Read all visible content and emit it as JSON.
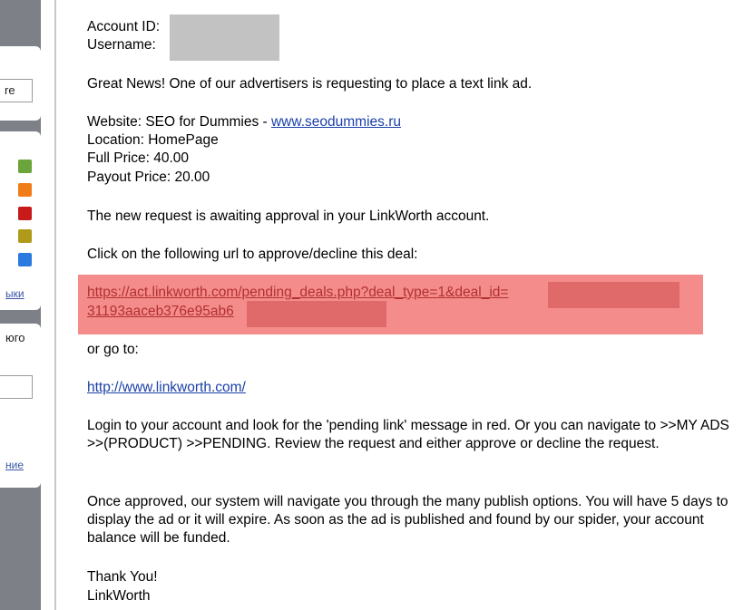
{
  "sidebar": {
    "input1_value": "re",
    "color_squares": [
      "#6aa43a",
      "#f07d1a",
      "#c81a1a",
      "#b09a1a",
      "#2a7ae0"
    ],
    "link1": "ыки",
    "label": "юго",
    "link2": "ние"
  },
  "email": {
    "account_id_label": "Account ID:",
    "username_label": "Username:",
    "intro": "Great News!  One of our advertisers is requesting to place a text link ad.",
    "website_label": "Website: SEO for Dummies - ",
    "website_link": "www.seodummies.ru",
    "location": "Location: HomePage",
    "full_price": "Full Price: 40.00",
    "payout_price": "Payout Price: 20.00",
    "awaiting": "The new request is awaiting approval in your LinkWorth account.",
    "click_instruction": "Click on the following url to approve/decline this deal:",
    "deal_url_line1": "https://act.linkworth.com/pending_deals.php?deal_type=1&deal_id=",
    "deal_url_line2": "31193aaceb376e95ab6",
    "or_go_to": "or go to:",
    "home_link": "http://www.linkworth.com/",
    "login_paragraph": "Login to your account and look for the 'pending link' message in red.  Or you can navigate to >>MY ADS >>(PRODUCT) >>PENDING.  Review the request and either approve or decline the request.",
    "approved_paragraph": "Once approved, our system will navigate you through the many publish options.  You will have 5 days to display the ad or it will expire.  As soon as the ad is published and found by our spider, your account balance will be funded.",
    "thanks": "Thank You!",
    "signature": "LinkWorth"
  },
  "colors": {
    "sidebar_bg": "#7d8087",
    "highlight": "#f58c8c",
    "link": "#1a3fa8"
  }
}
